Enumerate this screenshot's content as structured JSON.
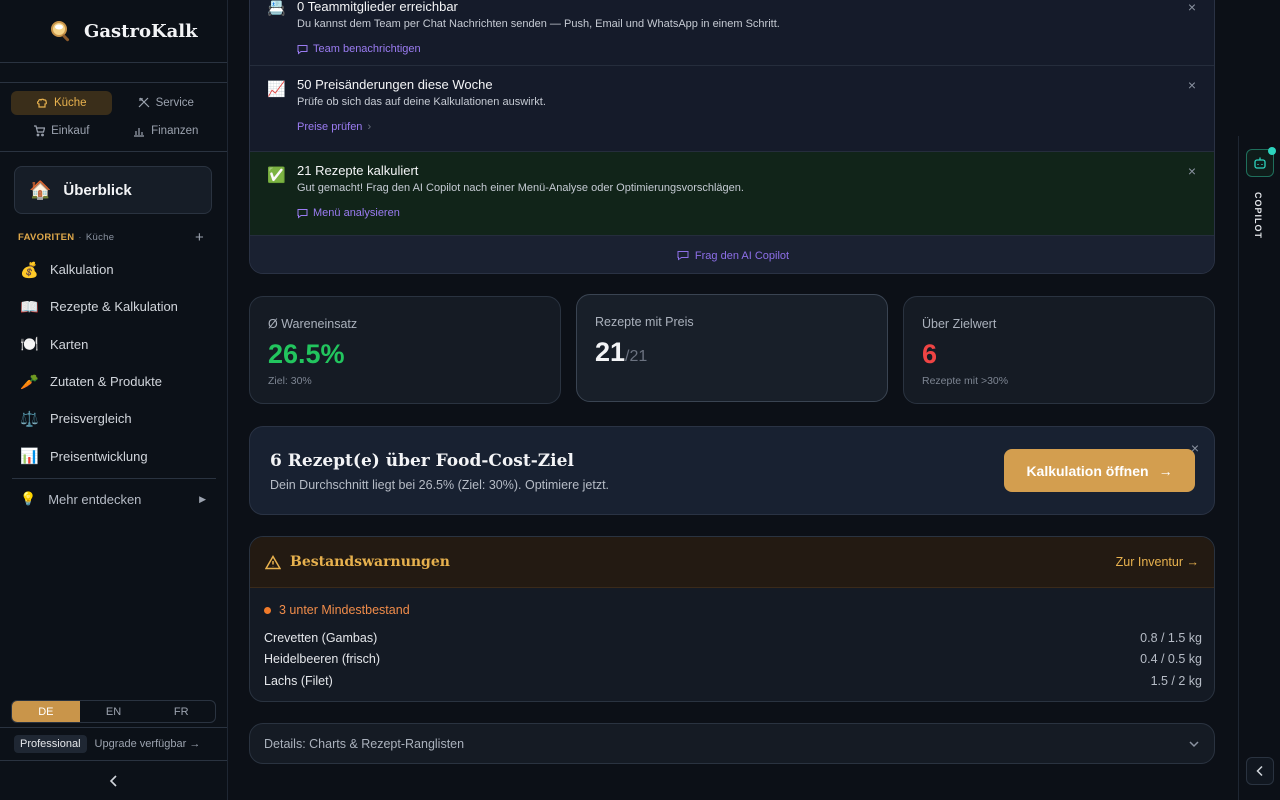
{
  "app": {
    "name": "GastroKalk"
  },
  "departments": [
    {
      "label": "Küche",
      "icon": "chef-hat-icon",
      "active": true
    },
    {
      "label": "Service",
      "icon": "utensils-icon",
      "active": false
    },
    {
      "label": "Einkauf",
      "icon": "cart-icon",
      "active": false
    },
    {
      "label": "Finanzen",
      "icon": "bar-chart-icon",
      "active": false
    }
  ],
  "overview": {
    "emoji": "🏠",
    "label": "Überblick"
  },
  "favorites": {
    "label": "FAVORITEN",
    "sep": "·",
    "context": "Küche",
    "add": "+"
  },
  "nav": [
    {
      "emoji": "💰",
      "label": "Kalkulation"
    },
    {
      "emoji": "📖",
      "label": "Rezepte & Kalkulation"
    },
    {
      "emoji": "🍽️",
      "label": "Karten"
    },
    {
      "emoji": "🥕",
      "label": "Zutaten & Produkte"
    },
    {
      "emoji": "⚖️",
      "label": "Preisvergleich"
    },
    {
      "emoji": "📊",
      "label": "Preisentwicklung"
    }
  ],
  "more": {
    "emoji": "💡",
    "label": "Mehr entdecken",
    "arrow": "▶"
  },
  "languages": [
    {
      "code": "DE",
      "active": true
    },
    {
      "code": "EN",
      "active": false
    },
    {
      "code": "FR",
      "active": false
    }
  ],
  "plan": {
    "badge": "Professional",
    "upgrade": "Upgrade verfügbar →"
  },
  "notifications": [
    {
      "emoji": "📇",
      "title": "0 Teammitglieder erreichbar",
      "desc": "Du kannst dem Team per Chat Nachrichten senden — Push, Email und WhatsApp in einem Schritt.",
      "action": "Team benachrichtigen",
      "close": "×"
    },
    {
      "emoji": "📈",
      "title": "50 Preisänderungen diese Woche",
      "desc": "Prüfe ob sich das auf deine Kalkulationen auswirkt.",
      "action": "Preise prüfen",
      "actionSuffix": "›",
      "close": "×"
    },
    {
      "emoji": "✅",
      "title": "21 Rezepte kalkuliert",
      "desc": "Gut gemacht! Frag den AI Copilot nach einer Menü-Analyse oder Optimierungsvorschlägen.",
      "action": "Menü analysieren",
      "close": "×"
    }
  ],
  "copilotLink": "Frag den AI Copilot",
  "stats": [
    {
      "label": "Ø Wareneinsatz",
      "value": "26.5%",
      "sub": "Ziel: 30%",
      "color": "#22c55e"
    },
    {
      "label": "Rezepte mit Preis",
      "value": "21",
      "valueSuffix": "/21",
      "color": "#f3f4f6"
    },
    {
      "label": "Über Zielwert",
      "value": "6",
      "sub": "Rezepte mit >30%",
      "color": "#ef4444"
    }
  ],
  "cta": {
    "title": "6 Rezept(e) über Food-Cost-Ziel",
    "text": "Dein Durchschnitt liegt bei 26.5% (Ziel: 30%). Optimiere jetzt.",
    "button": "Kalkulation öffnen",
    "buttonArrow": "→",
    "close": "×"
  },
  "stockWarnings": {
    "title": "Bestandswarnungen",
    "link": "Zur Inventur →",
    "subtitle": "3 unter Mindestbestand",
    "items": [
      {
        "name": "Crevetten (Gambas)",
        "amount": "0.8 / 1.5 kg"
      },
      {
        "name": "Heidelbeeren (frisch)",
        "amount": "0.4 / 0.5 kg"
      },
      {
        "name": "Lachs (Filet)",
        "amount": "1.5 / 2 kg"
      }
    ]
  },
  "details": {
    "label": "Details: Charts & Rezept-Ranglisten"
  },
  "copilotRail": {
    "label": "COPILOT"
  },
  "colors": {
    "accent": "#d39e4f",
    "purple": "#9b7cf2",
    "good": "#22c55e",
    "bad": "#ef4444"
  }
}
